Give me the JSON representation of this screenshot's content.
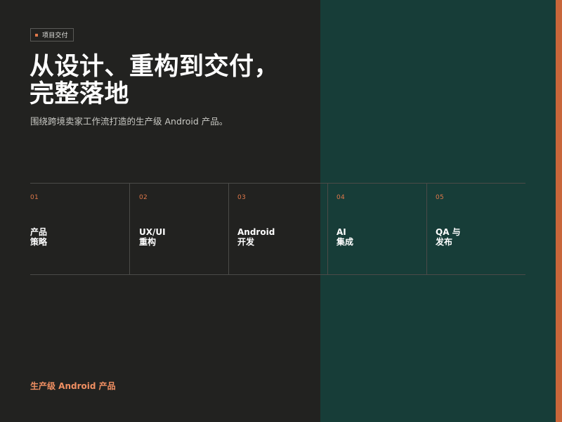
{
  "tag": {
    "label": "项目交付"
  },
  "hero": {
    "title_line1": "从设计、重构到交付，",
    "title_line2": "完整落地",
    "subtitle": "围绕跨境卖家工作流打造的生产级 Android 产品。"
  },
  "steps": [
    {
      "num": "01",
      "line1": "产品",
      "line2": "策略"
    },
    {
      "num": "02",
      "line1": "UX/UI",
      "line2": "重构"
    },
    {
      "num": "03",
      "line1": "Android",
      "line2": "开发"
    },
    {
      "num": "04",
      "line1": "AI",
      "line2": "集成"
    },
    {
      "num": "05",
      "line1": "QA 与",
      "line2": "发布"
    }
  ],
  "footer": {
    "label": "生产级 Android 产品"
  },
  "colors": {
    "background_dark": "#222220",
    "background_green": "#173d38",
    "accent": "#c8663a",
    "accent_text": "#e0784a"
  }
}
